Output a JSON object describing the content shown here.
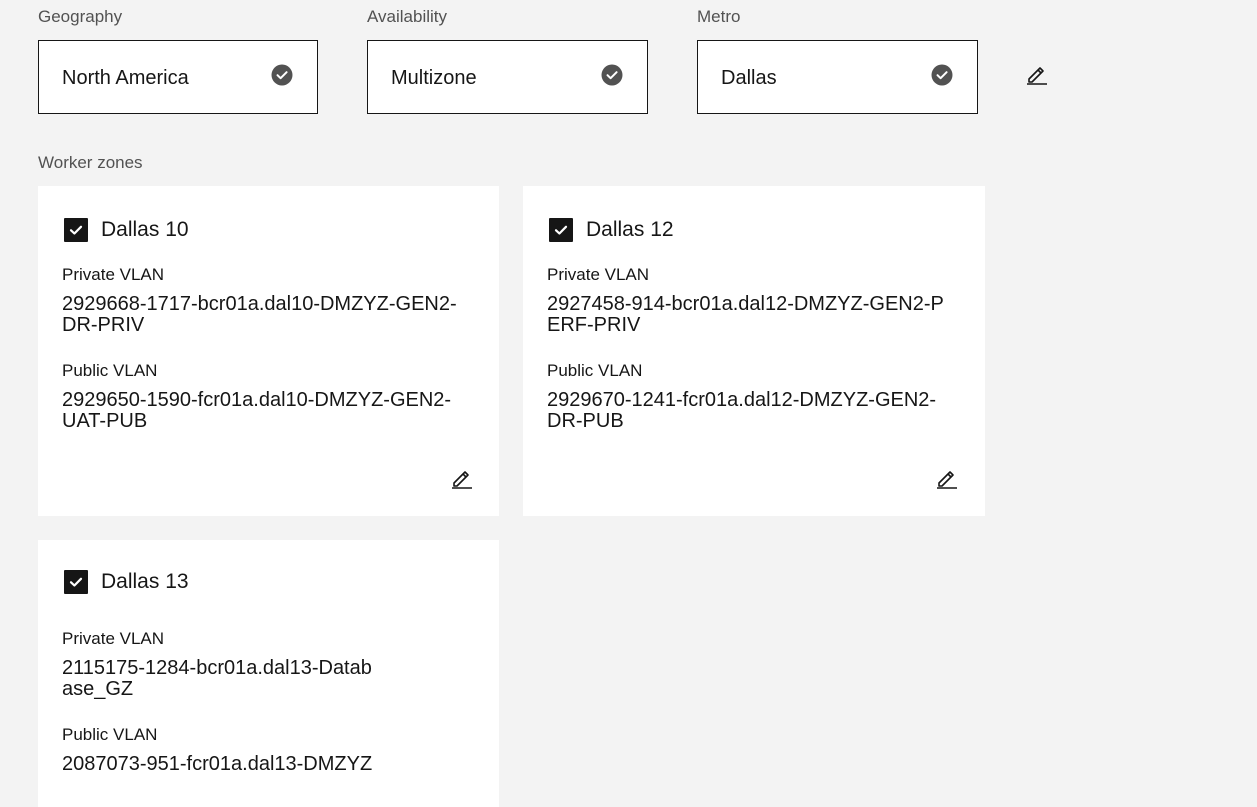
{
  "filters": {
    "geography": {
      "label": "Geography",
      "value": "North America"
    },
    "availability": {
      "label": "Availability",
      "value": "Multizone"
    },
    "metro": {
      "label": "Metro",
      "value": "Dallas"
    }
  },
  "worker_zones": {
    "label": "Worker zones",
    "zones": [
      {
        "name": "Dallas 10",
        "checked": true,
        "private_vlan_label": "Private VLAN",
        "private_vlan": "2929668-1717-bcr01a.dal10-DMZYZ-GEN2-DR-PRIV",
        "public_vlan_label": "Public VLAN",
        "public_vlan": "2929650-1590-fcr01a.dal10-DMZYZ-GEN2-UAT-PUB"
      },
      {
        "name": "Dallas 12",
        "checked": true,
        "private_vlan_label": "Private VLAN",
        "private_vlan": "2927458-914-bcr01a.dal12-DMZYZ-GEN2-PERF-PRIV",
        "public_vlan_label": "Public VLAN",
        "public_vlan": "2929670-1241-fcr01a.dal12-DMZYZ-GEN2-DR-PUB"
      },
      {
        "name": "Dallas 13",
        "checked": true,
        "private_vlan_label": "Private VLAN",
        "private_vlan": "2115175-1284-bcr01a.dal13-Database_GZ",
        "public_vlan_label": "Public VLAN",
        "public_vlan": "2087073-951-fcr01a.dal13-DMZYZ"
      }
    ]
  },
  "icons": {
    "selected": "checkmark-filled-icon",
    "edit": "edit-pencil-icon",
    "checkbox": "checkbox-checked-icon"
  },
  "colors": {
    "page_background": "#f3f3f3",
    "card_background": "#ffffff",
    "text_primary": "#161616",
    "text_secondary": "#525252",
    "icon_fill": "#525252"
  }
}
